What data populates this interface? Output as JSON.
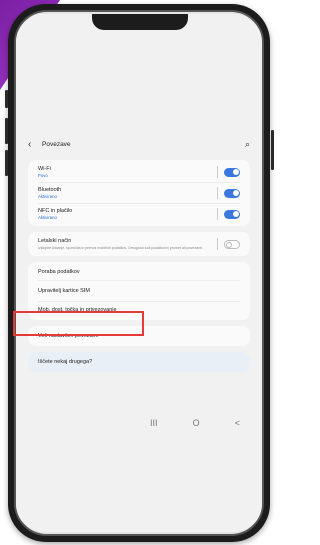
{
  "header": {
    "title": "Povezave"
  },
  "icons": {
    "back": "chevron-left-icon",
    "search": "search-icon"
  },
  "connectivity": [
    {
      "title": "Wi-Fi",
      "sub": "Povo",
      "toggle": "on"
    },
    {
      "title": "Bluetooth",
      "sub": "Aktivirano",
      "toggle": "on"
    },
    {
      "title": "NFC in plačilo",
      "sub": "Aktivirano",
      "toggle": "on"
    }
  ],
  "airplane": {
    "title": "Letalski način",
    "desc": "Izklopite klicanje, sporočila in prenos mobilnih podatkov. Omogoča tudi podatkovni promet ali povezave.",
    "toggle": "off"
  },
  "data_usage": {
    "title": "Poraba podatkov"
  },
  "sim_manager": {
    "title": "Upravitelj kartice SIM"
  },
  "hotspot": {
    "title": "Mob. dost. točka in privezovanje"
  },
  "more_settings": {
    "title": "Več nastavitev povezave"
  },
  "suggest": {
    "title": "Iščete nekaj drugega?"
  },
  "nav": {
    "recent": "III",
    "home": "O",
    "back": "<"
  },
  "colors": {
    "accent": "#3a78e0",
    "highlight": "#e53935"
  }
}
